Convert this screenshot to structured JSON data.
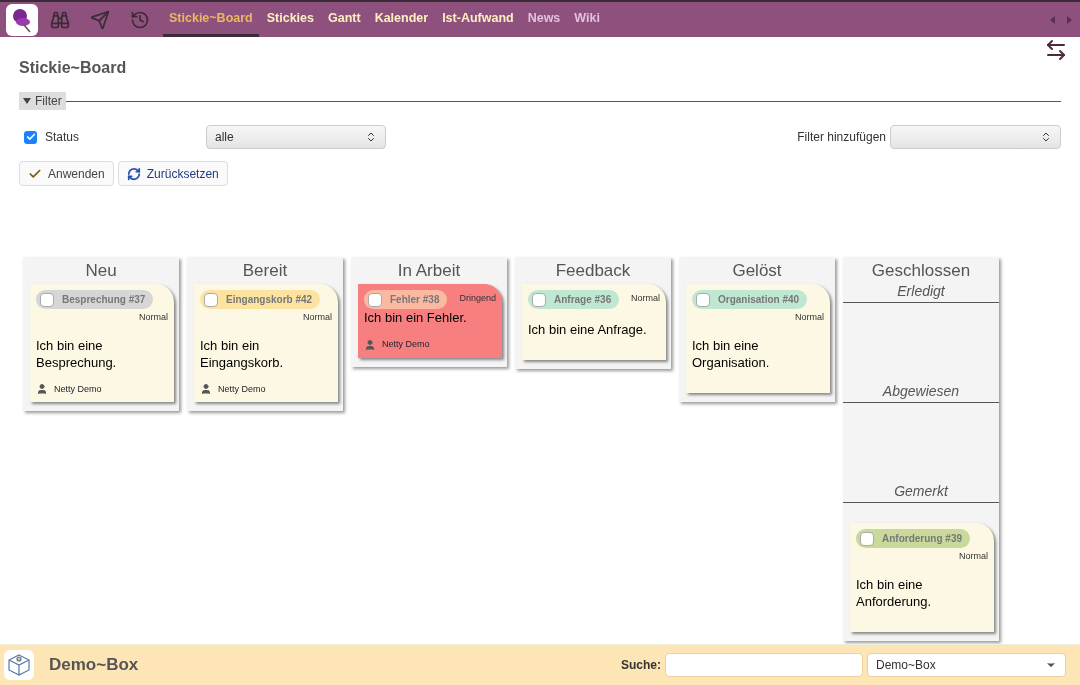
{
  "nav": {
    "tabs": [
      {
        "label": "Stickie~Board",
        "selected": true,
        "disabled": false
      },
      {
        "label": "Stickies",
        "selected": false,
        "disabled": false
      },
      {
        "label": "Gantt",
        "selected": false,
        "disabled": false
      },
      {
        "label": "Kalender",
        "selected": false,
        "disabled": false
      },
      {
        "label": "Ist-Aufwand",
        "selected": false,
        "disabled": false
      },
      {
        "label": "News",
        "selected": false,
        "disabled": true
      },
      {
        "label": "Wiki",
        "selected": false,
        "disabled": true
      }
    ]
  },
  "page_title": "Stickie~Board",
  "filter": {
    "legend": "Filter",
    "expanded": true,
    "status_label": "Status",
    "status_checked": true,
    "status_value": "alle",
    "add_label": "Filter hinzufügen"
  },
  "buttons": [
    {
      "kind": "apply",
      "label": "Anwenden"
    },
    {
      "kind": "reset",
      "label": "Zurücksetzen"
    }
  ],
  "columns": [
    {
      "title": "Neu",
      "cards": [
        {
          "tag": "Besprechung #37",
          "color": "#d6d6d6",
          "checked": false,
          "priority": "Normal",
          "urgent": false,
          "text": "Ich bin eine Besprechung.",
          "author": "Netty Demo"
        }
      ]
    },
    {
      "title": "Bereit",
      "cards": [
        {
          "tag": "Eingangskorb #42",
          "color": "#fde3a0",
          "checked": false,
          "priority": "Normal",
          "urgent": false,
          "text": "Ich bin ein Eingangskorb.",
          "author": "Netty Demo"
        }
      ]
    },
    {
      "title": "In Arbeit",
      "cards": [
        {
          "tag": "Fehler #38",
          "color": "#fbb9a2",
          "checked": false,
          "priority": "Dringend",
          "urgent": true,
          "text": "Ich bin ein Fehler.",
          "author": "Netty Demo"
        }
      ]
    },
    {
      "title": "Feedback",
      "cards": [
        {
          "tag": "Anfrage #36",
          "color": "#bfe8d2",
          "checked": false,
          "priority": "Normal",
          "urgent": false,
          "text": "Ich bin eine Anfrage."
        }
      ]
    },
    {
      "title": "Gelöst",
      "cards": [
        {
          "tag": "Organisation #40",
          "color": "#bfe8d2",
          "checked": false,
          "priority": "Normal",
          "urgent": false,
          "text": "Ich bin eine Organisation."
        }
      ]
    },
    {
      "title": "Geschlossen",
      "sections": [
        {
          "title": "Erledigt"
        },
        {
          "title": "Abgewiesen"
        },
        {
          "title": "Gemerkt",
          "cards": [
            {
              "tag": "Anforderung #39",
              "color": "#c8d99b",
              "checked": false,
              "priority": "Normal",
              "urgent": false,
              "text": "Ich bin eine Anforderung."
            }
          ]
        }
      ]
    }
  ],
  "footer": {
    "title": "Demo~Box",
    "search_label": "Suche:",
    "project": "Demo~Box"
  }
}
